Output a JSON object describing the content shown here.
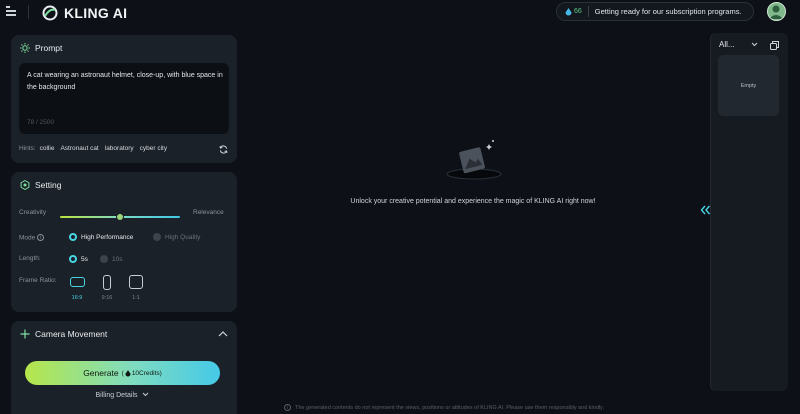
{
  "header": {
    "logo_text": "KLING AI",
    "credits": "66",
    "notice": "Getting ready for our subscription programs."
  },
  "prompt": {
    "title": "Prompt",
    "text": "A cat wearing an astronaut helmet, close-up, with blue space in the background",
    "counter": "78 / 2500",
    "hints_label": "Hints:",
    "hints": [
      "collie",
      "Astronaut cat",
      "laboratory",
      "cyber city"
    ]
  },
  "setting": {
    "title": "Setting",
    "creativity_label": "Creativity",
    "relevance_label": "Relevance",
    "slider_value": 0.5,
    "mode_label": "Mode",
    "mode_options": [
      "High Performance",
      "High Quality"
    ],
    "length_label": "Length:",
    "length_options": [
      "5s",
      "10s"
    ],
    "ratio_label": "Frame Ratio:",
    "ratios": [
      "16:9",
      "9:16",
      "1:1"
    ]
  },
  "camera": {
    "title": "Camera Movement"
  },
  "generate": {
    "label": "Generate",
    "open_paren": "(",
    "credits": "10",
    "credits_unit": "Credits",
    "close_paren": ")"
  },
  "billing_label": "Billing Details",
  "main": {
    "message": "Unlock your creative potential and experience the magic of KLING AI right now!"
  },
  "gallery": {
    "filter": "All...",
    "empty_label": "Empty"
  },
  "footer": {
    "disclaimer": "The generated contents do not represent the views, positions or attitudes of KLING AI. Please use them responsibly and kindly."
  },
  "colors": {
    "accent": "#47d5e4",
    "lime": "#b6e64a",
    "background": "#0d1117",
    "panel": "#1b2128"
  }
}
